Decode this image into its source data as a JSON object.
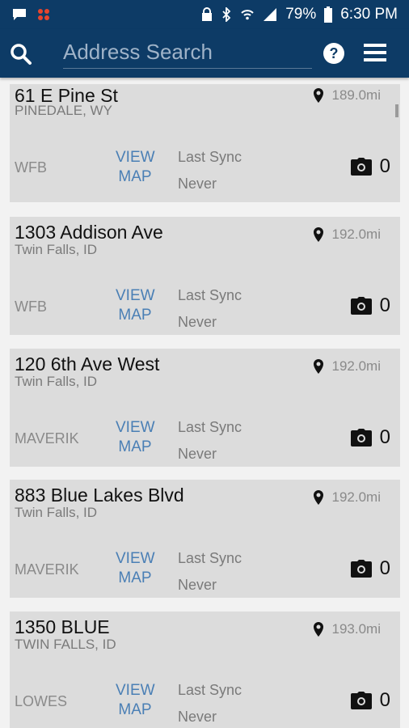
{
  "status_bar": {
    "battery_percent": "79%",
    "time": "6:30 PM"
  },
  "app_bar": {
    "search_placeholder": "Address Search",
    "search_value": ""
  },
  "colors": {
    "primary": "#0d3b66",
    "card_bg": "#dcdcdc",
    "link": "#4a7fb5"
  },
  "list": {
    "view_map_line1": "VIEW",
    "view_map_line2": "MAP",
    "sync_label": "Last Sync",
    "items": [
      {
        "address": "61 E Pine St",
        "city": "PINEDALE, WY",
        "distance": "189.0mi",
        "store": "WFB",
        "sync_value": "Never",
        "photo_count": "0"
      },
      {
        "address": "1303 Addison Ave",
        "city": "Twin Falls, ID",
        "distance": "192.0mi",
        "store": "WFB",
        "sync_value": "Never",
        "photo_count": "0"
      },
      {
        "address": "120  6th  Ave West",
        "city": "Twin Falls, ID",
        "distance": "192.0mi",
        "store": "MAVERIK",
        "sync_value": "Never",
        "photo_count": "0"
      },
      {
        "address": "883 Blue Lakes Blvd",
        "city": "Twin Falls, ID",
        "distance": "192.0mi",
        "store": "MAVERIK",
        "sync_value": "Never",
        "photo_count": "0"
      },
      {
        "address": "1350 BLUE",
        "city": "TWIN FALLS, ID",
        "distance": "193.0mi",
        "store": "LOWES",
        "sync_value": "Never",
        "photo_count": "0"
      }
    ]
  }
}
